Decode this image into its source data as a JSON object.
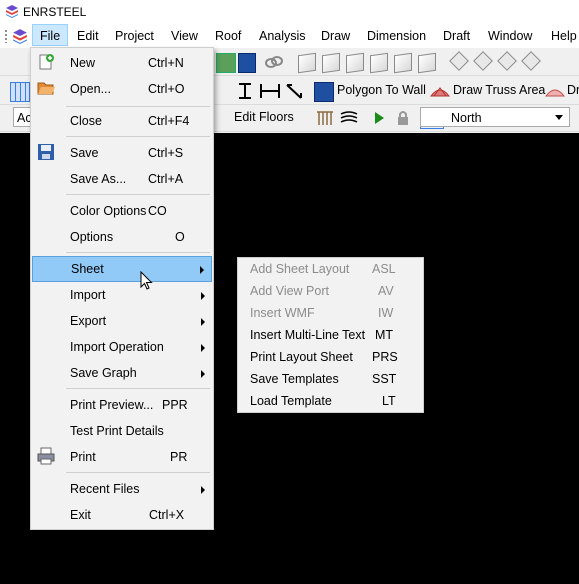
{
  "app": {
    "title": "ENRSTEEL"
  },
  "menubar": {
    "items": [
      {
        "label": "File"
      },
      {
        "label": "Edit"
      },
      {
        "label": "Project"
      },
      {
        "label": "View"
      },
      {
        "label": "Roof"
      },
      {
        "label": "Analysis"
      },
      {
        "label": "Draw"
      },
      {
        "label": "Dimension"
      },
      {
        "label": "Draft"
      },
      {
        "label": "Window"
      },
      {
        "label": "Help"
      }
    ],
    "active": "File"
  },
  "toolbar2": {
    "polygon_to_wall": "Polygon To Wall",
    "draw_truss_area": "Draw Truss Area",
    "cut_label": "Dr"
  },
  "toolbar3": {
    "left_cut": "Ac",
    "edit_floors": "Edit Floors",
    "direction_combo": "North"
  },
  "file_menu": {
    "items": [
      {
        "label": "New",
        "shortcut": "Ctrl+N",
        "icon": "new-file-icon"
      },
      {
        "label": "Open...",
        "shortcut": "Ctrl+O",
        "icon": "open-folder-icon"
      },
      {
        "label": "Close",
        "shortcut": "Ctrl+F4"
      },
      {
        "label": "Save",
        "shortcut": "Ctrl+S",
        "icon": "floppy-disk-icon"
      },
      {
        "label": "Save As...",
        "shortcut": "Ctrl+A"
      },
      {
        "label": "Color Options",
        "shortcut": "CO"
      },
      {
        "label": "Options",
        "shortcut": "O"
      },
      {
        "label": "Sheet",
        "submenu": true,
        "highlighted": true
      },
      {
        "label": "Import",
        "submenu": true
      },
      {
        "label": "Export",
        "submenu": true
      },
      {
        "label": "Import Operation",
        "submenu": true
      },
      {
        "label": "Save Graph",
        "submenu": true
      },
      {
        "label": "Print Preview...",
        "shortcut": "PPR"
      },
      {
        "label": "Test Print Details"
      },
      {
        "label": "Print",
        "shortcut": "PR",
        "icon": "printer-icon"
      },
      {
        "label": "Recent Files",
        "submenu": true
      },
      {
        "label": "Exit",
        "shortcut": "Ctrl+X"
      }
    ]
  },
  "sheet_submenu": {
    "items": [
      {
        "label": "Add Sheet Layout",
        "shortcut": "ASL",
        "enabled": false
      },
      {
        "label": "Add View Port",
        "shortcut": "AV",
        "enabled": false
      },
      {
        "label": "Insert WMF",
        "shortcut": "IW",
        "enabled": false
      },
      {
        "label": "Insert Multi-Line Text",
        "shortcut": "MT",
        "enabled": true
      },
      {
        "label": "Print Layout Sheet",
        "shortcut": "PRS",
        "enabled": true
      },
      {
        "label": "Save Templates",
        "shortcut": "SST",
        "enabled": true
      },
      {
        "label": "Load Template",
        "shortcut": "LT",
        "enabled": true
      }
    ]
  },
  "colors": {
    "highlight": "#91c9f7",
    "canvas": "#000000",
    "menubar_active": "#cce8ff"
  }
}
